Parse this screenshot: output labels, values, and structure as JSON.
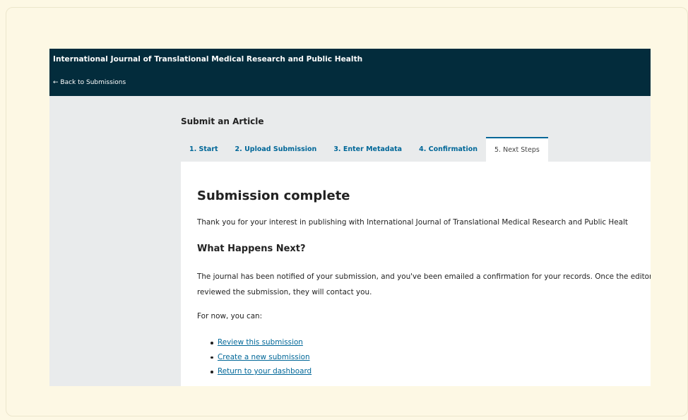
{
  "header": {
    "journal_title": "International Journal of Translational Medical Research and Public Health",
    "back_link": "← Back to Submissions"
  },
  "page": {
    "title": "Submit an Article"
  },
  "tabs": [
    {
      "label": "1. Start",
      "active": false
    },
    {
      "label": "2. Upload Submission",
      "active": false
    },
    {
      "label": "3. Enter Metadata",
      "active": false
    },
    {
      "label": "4. Confirmation",
      "active": false
    },
    {
      "label": "5. Next Steps",
      "active": true
    }
  ],
  "content": {
    "heading": "Submission complete",
    "thanks": "Thank you for your interest in publishing with International Journal of Translational Medical Research and Public Healt",
    "subheading": "What Happens Next?",
    "notification": "The journal has been notified of your submission, and you've been emailed a confirmation for your records. Once the editor has reviewed the submission, they will contact you.",
    "for_now": "For now, you can:",
    "actions": [
      "Review this submission",
      "Create a new submission",
      "Return to your dashboard"
    ]
  },
  "colors": {
    "header_bg": "#032c3c",
    "link": "#006798",
    "page_bg": "#e9ebec",
    "outer_bg": "#fdf8e4"
  }
}
